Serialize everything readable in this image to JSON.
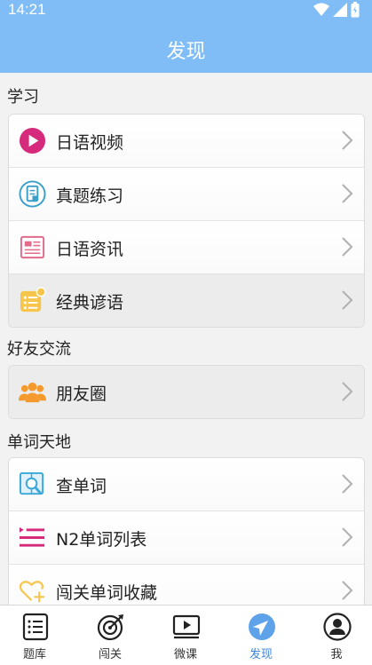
{
  "status_bar": {
    "time": "14:21"
  },
  "header": {
    "title": "发现"
  },
  "sections": [
    {
      "title": "学习",
      "items": [
        {
          "label": "日语视频",
          "icon": "play-video-icon"
        },
        {
          "label": "真题练习",
          "icon": "exam-paper-icon"
        },
        {
          "label": "日语资讯",
          "icon": "news-icon"
        },
        {
          "label": "经典谚语",
          "icon": "proverb-list-icon"
        }
      ]
    },
    {
      "title": "好友交流",
      "items": [
        {
          "label": "朋友圈",
          "icon": "friends-group-icon"
        }
      ]
    },
    {
      "title": "单词天地",
      "items": [
        {
          "label": "查单词",
          "icon": "search-word-icon"
        },
        {
          "label": "N2单词列表",
          "icon": "word-list-icon"
        },
        {
          "label": "闯关单词收藏",
          "icon": "favorite-heart-icon"
        }
      ]
    }
  ],
  "bottom_nav": [
    {
      "label": "题库",
      "icon": "question-bank-icon"
    },
    {
      "label": "闯关",
      "icon": "target-icon"
    },
    {
      "label": "微课",
      "icon": "video-lesson-icon"
    },
    {
      "label": "发现",
      "icon": "compass-icon",
      "active": true
    },
    {
      "label": "我",
      "icon": "user-icon"
    }
  ],
  "colors": {
    "header": "#80bdf6",
    "active_tab": "#3f86d8"
  }
}
